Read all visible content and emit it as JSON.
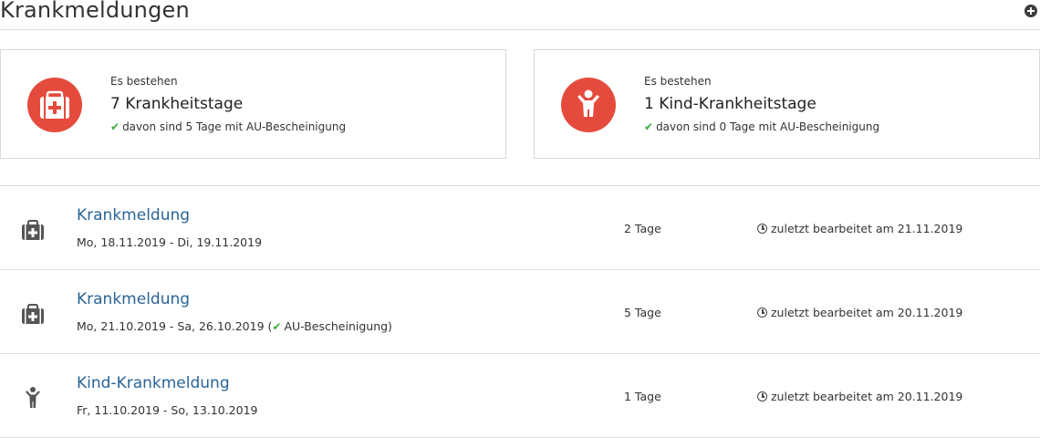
{
  "header": {
    "title": "Krankmeldungen"
  },
  "summary": [
    {
      "label": "Es bestehen",
      "value": "7 Krankheitstage",
      "sub": "davon sind 5 Tage mit AU-Bescheinigung",
      "icon": "first-aid-kit-icon"
    },
    {
      "label": "Es bestehen",
      "value": "1 Kind-Krankheitstage",
      "sub": "davon sind 0 Tage mit AU-Bescheinigung",
      "icon": "child-icon"
    }
  ],
  "entries": [
    {
      "title": "Krankmeldung",
      "dates": "Mo, 18.11.2019 - Di, 19.11.2019",
      "au": "",
      "days": "2 Tage",
      "edited": "zuletzt bearbeitet am 21.11.2019",
      "icon": "first-aid-kit-icon"
    },
    {
      "title": "Krankmeldung",
      "dates": "Mo, 21.10.2019 - Sa, 26.10.2019 (",
      "au": "AU-Bescheinigung)",
      "days": "5 Tage",
      "edited": "zuletzt bearbeitet am 20.11.2019",
      "icon": "first-aid-kit-icon"
    },
    {
      "title": "Kind-Krankmeldung",
      "dates": "Fr, 11.10.2019 - So, 13.10.2019",
      "au": "",
      "days": "1 Tage",
      "edited": "zuletzt bearbeitet am 20.11.2019",
      "icon": "child-icon"
    }
  ],
  "colors": {
    "accent_red": "#e54b3d",
    "link_blue": "#2a6496",
    "check_green": "#3aaa35"
  }
}
